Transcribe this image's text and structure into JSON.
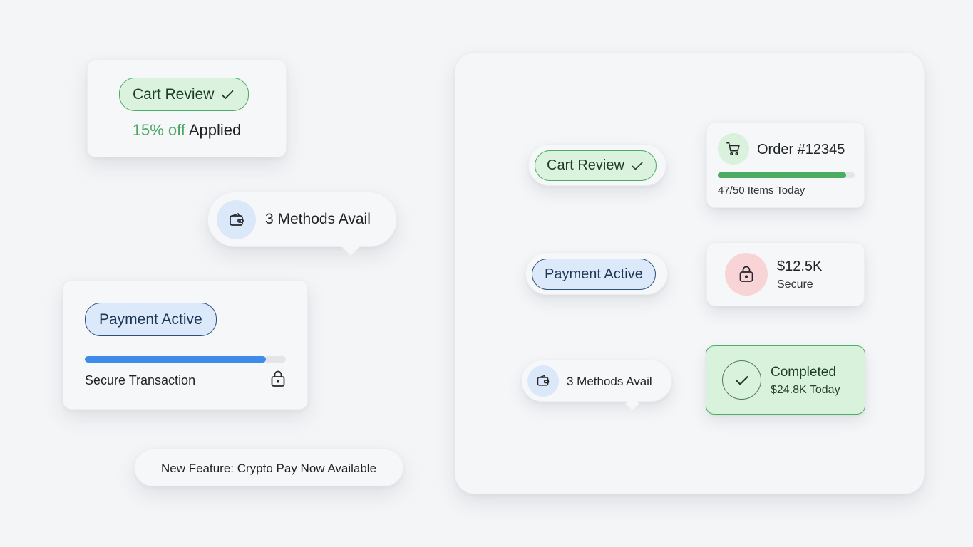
{
  "colors": {
    "background": "#f4f5f7",
    "success_green": "#4aa862",
    "pill_green_bg": "#dbf3de",
    "pill_blue_bg": "#dce9fa",
    "progress_blue": "#3e8ce9",
    "danger_soft": "#f8d4d6"
  },
  "cart_card": {
    "pill_label": "Cart Review",
    "pill_icon": "check-icon",
    "discount_value": "15% off",
    "discount_suffix": "Applied"
  },
  "methods_bubble": {
    "icon": "wallet-icon",
    "label": "3 Methods Avail"
  },
  "payment_card": {
    "pill_label": "Payment Active",
    "progress": 0.9,
    "caption": "Secure Transaction",
    "icon": "lock-icon"
  },
  "feature_pill": {
    "label": "New Feature: Crypto Pay Now Available"
  },
  "panel": {
    "cart_chip": {
      "label": "Cart Review",
      "icon": "check-icon"
    },
    "payment_chip": {
      "label": "Payment Active"
    },
    "methods_chip": {
      "label": "3 Methods Avail",
      "icon": "wallet-icon"
    },
    "order_card": {
      "icon": "cart-icon",
      "title": "Order #12345",
      "progress": 0.94,
      "caption": "47/50 Items Today"
    },
    "secure_card": {
      "icon": "lock-icon",
      "amount": "$12.5K",
      "caption": "Secure"
    },
    "completed_card": {
      "icon": "check-icon",
      "title": "Completed",
      "caption": "$24.8K Today"
    }
  }
}
